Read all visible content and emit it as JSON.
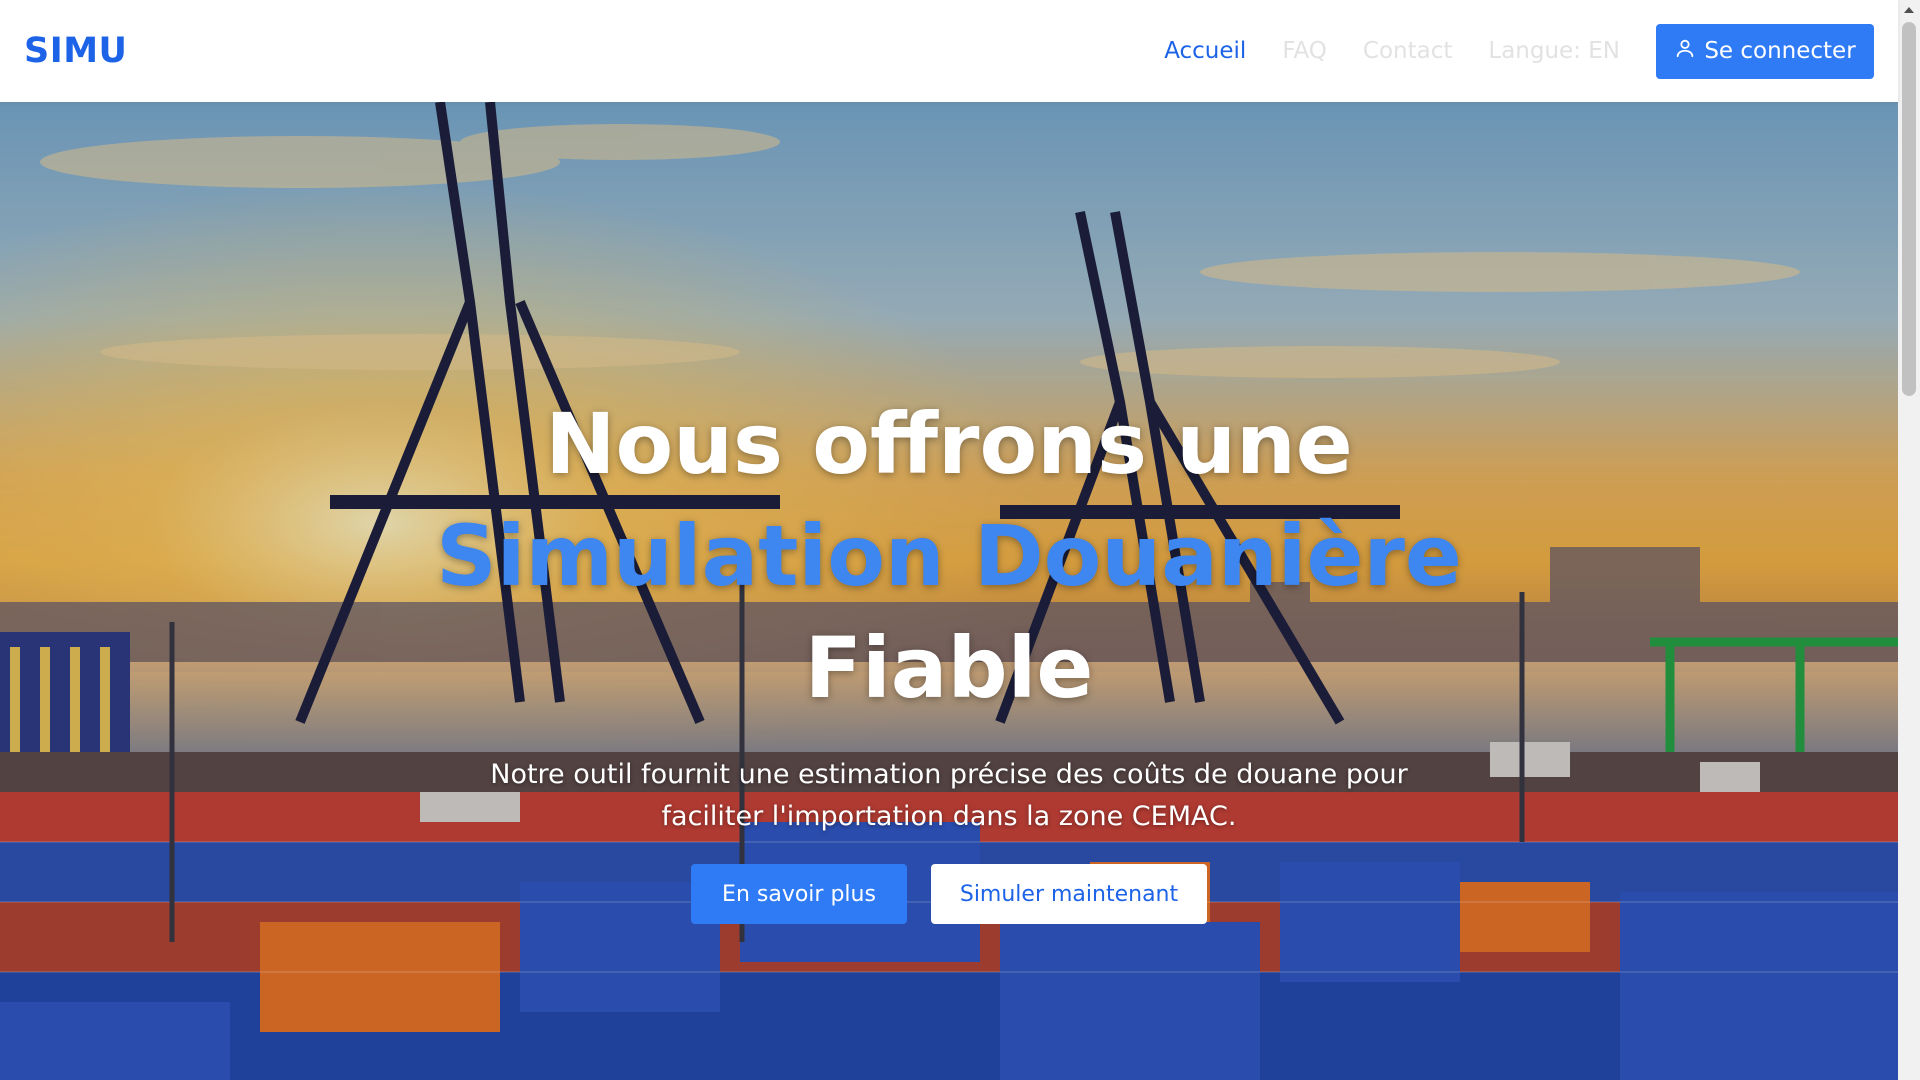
{
  "brand": {
    "name": "SIMU"
  },
  "nav": {
    "links": [
      {
        "label": "Accueil"
      },
      {
        "label": "FAQ"
      },
      {
        "label": "Contact"
      },
      {
        "label": "Langue: EN"
      }
    ],
    "login_label": "Se connecter"
  },
  "hero": {
    "headline_line1": "Nous offrons une",
    "headline_line2": "Simulation Douanière",
    "headline_line3": "Fiable",
    "subtitle": "Notre outil fournit une estimation précise des coûts de douane pour faciliter l'importation dans la zone CEMAC.",
    "cta_primary": "En savoir plus",
    "cta_secondary": "Simuler maintenant"
  },
  "colors": {
    "brand_blue": "#1d63e8",
    "button_blue": "#2f7bf5",
    "accent_blue": "#3e86f0"
  },
  "icons": {
    "login_icon": "user-icon"
  }
}
